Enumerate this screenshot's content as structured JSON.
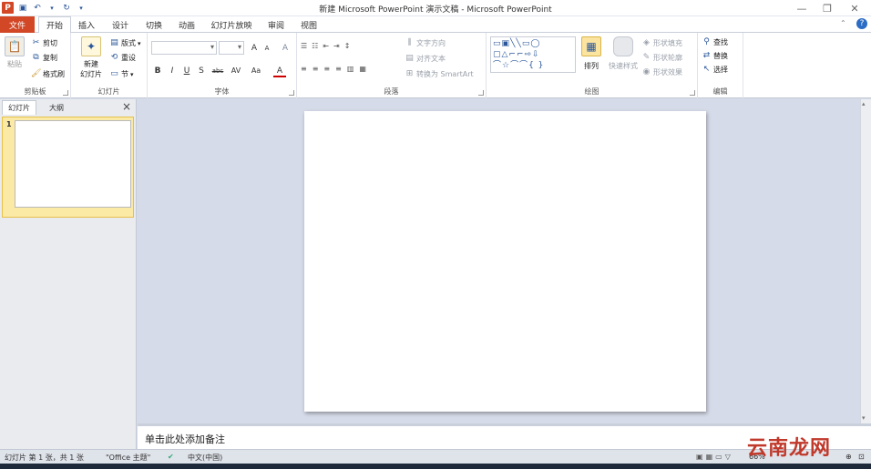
{
  "window": {
    "title": "新建 Microsoft PowerPoint 演示文稿 - Microsoft PowerPoint",
    "app_icon": "P"
  },
  "tabs": [
    "文件",
    "开始",
    "插入",
    "设计",
    "切换",
    "动画",
    "幻灯片放映",
    "审阅",
    "视图"
  ],
  "ribbon": {
    "clipboard": {
      "paste": "粘贴",
      "cut": "剪切",
      "copy": "复制",
      "format_painter": "格式刷",
      "label": "剪贴板"
    },
    "slides": {
      "new_slide_line1": "新建",
      "new_slide_line2": "幻灯片",
      "layout": "版式",
      "reset": "重设",
      "section": "节",
      "label": "幻灯片"
    },
    "font": {
      "label": "字体",
      "bold": "B",
      "italic": "I",
      "underline": "U",
      "shadow": "S",
      "strike": "abc",
      "spacing": "AV",
      "case": "Aa",
      "grow": "A",
      "shrink": "A",
      "clear": "A",
      "color": "A"
    },
    "paragraph": {
      "label": "段落",
      "text_direction": "文字方向",
      "align_text": "对齐文本",
      "smartart": "转换为 SmartArt"
    },
    "drawing": {
      "label": "绘图",
      "arrange": "排列",
      "quick_styles": "快速样式",
      "shape_fill": "形状填充",
      "shape_outline": "形状轮廓",
      "shape_effects": "形状效果"
    },
    "editing": {
      "label": "编辑",
      "find": "查找",
      "replace": "替换",
      "select": "选择"
    }
  },
  "panel": {
    "tab_slides": "幻灯片",
    "tab_outline": "大纲",
    "close": "×",
    "slide_number": "1"
  },
  "notes": {
    "placeholder": "单击此处添加备注"
  },
  "status": {
    "slide_info": "幻灯片 第 1 张，共 1 张",
    "theme": "\"Office 主题\"",
    "language": "中文(中国)",
    "zoom": "66%"
  },
  "watermark": "云南龙网"
}
